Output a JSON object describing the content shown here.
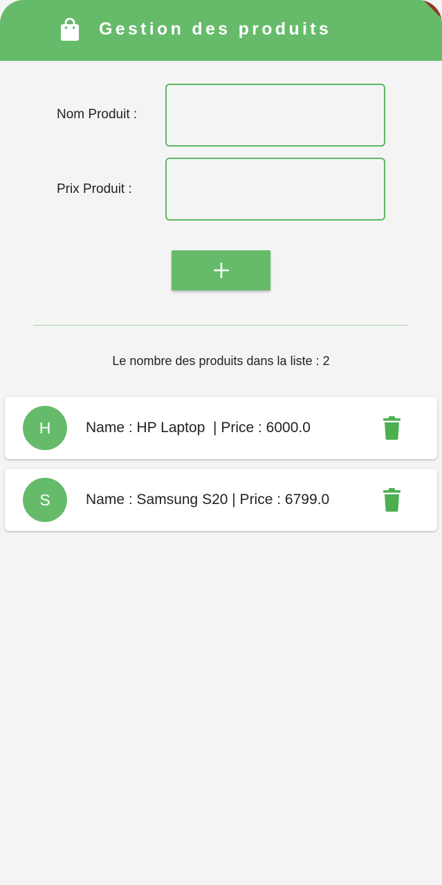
{
  "appbar": {
    "title": "Gestion des produits",
    "icon": "shopping-bag-icon",
    "color": "#66bb6a"
  },
  "form": {
    "name_label": "Nom Produit :",
    "name_value": "",
    "price_label": "Prix Produit :",
    "price_value": "",
    "add_button_icon": "plus-icon"
  },
  "count_text": "Le nombre des produits dans la liste : 2",
  "products": [
    {
      "avatar": "H",
      "text": "Name : HP Laptop  | Price : 6000.0",
      "delete_icon": "trash-icon"
    },
    {
      "avatar": "S",
      "text": "Name : Samsung S20 | Price : 6799.0",
      "delete_icon": "trash-icon"
    }
  ],
  "colors": {
    "accent": "#66bb6a",
    "background": "#f4f4f4",
    "card": "#ffffff"
  }
}
